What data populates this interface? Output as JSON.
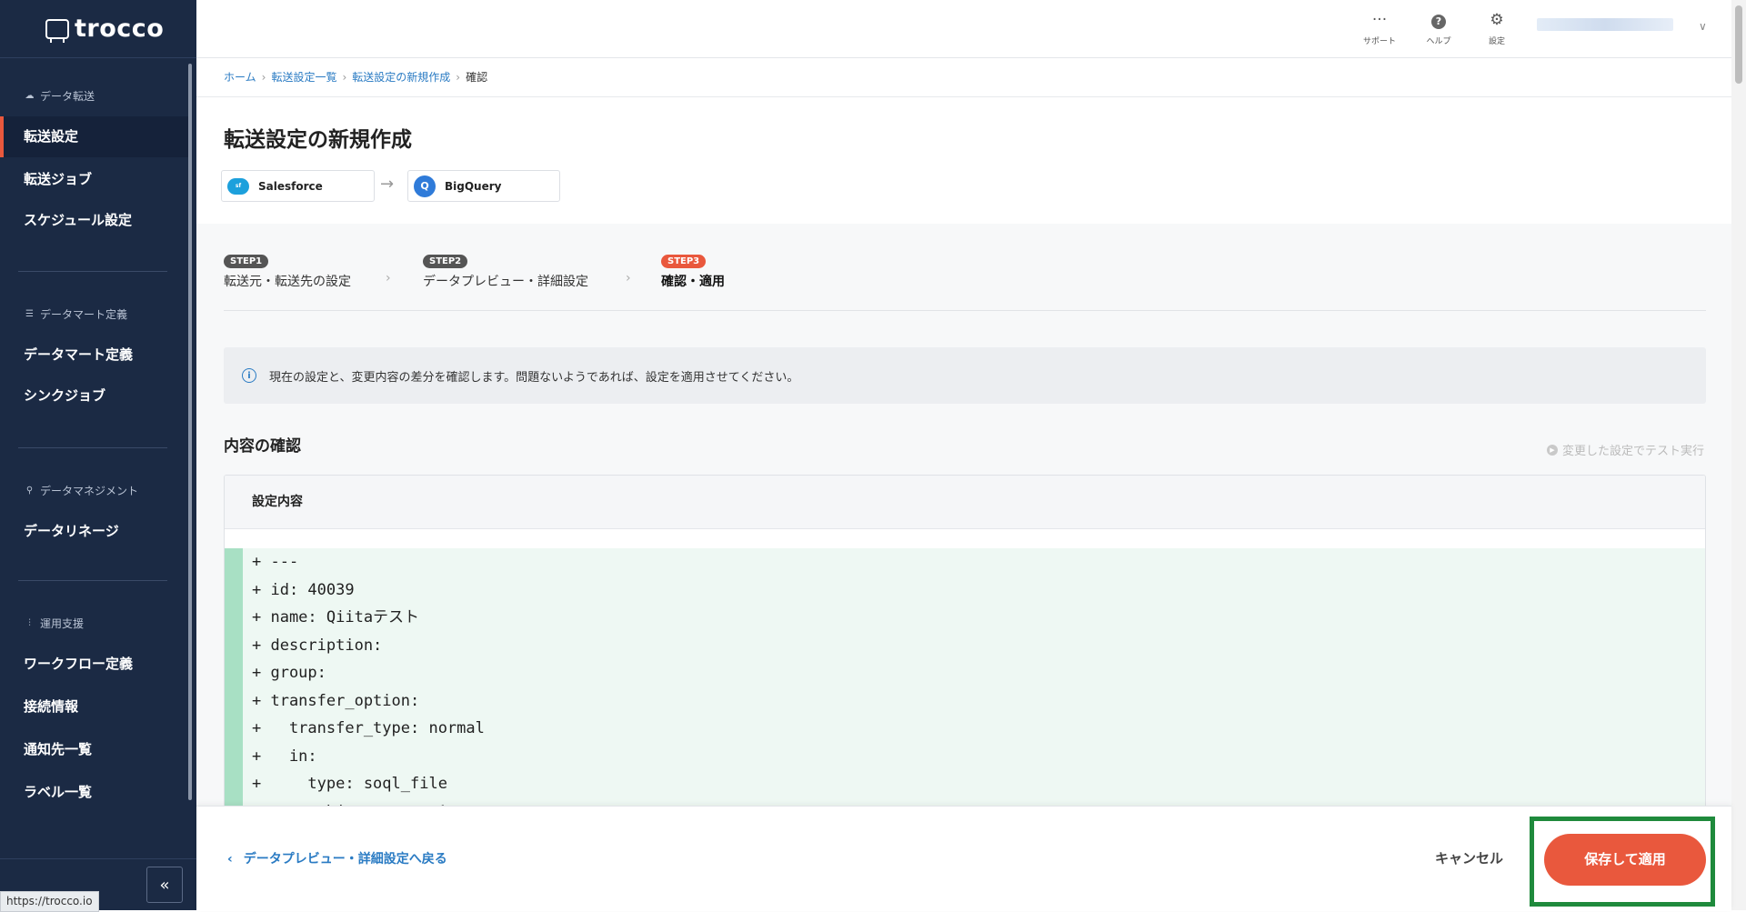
{
  "app": {
    "logo": "trocco"
  },
  "sidebar": {
    "sections": [
      {
        "title": "データ転送",
        "icon": "cloud-icon",
        "items": [
          "転送設定",
          "転送ジョブ",
          "スケジュール設定"
        ]
      },
      {
        "title": "データマート定義",
        "icon": "list-icon",
        "items": [
          "データマート定義",
          "シンクジョブ"
        ]
      },
      {
        "title": "データマネジメント",
        "icon": "lineage-icon",
        "items": [
          "データリネージ"
        ]
      },
      {
        "title": "運用支援",
        "icon": "sliders-icon",
        "items": [
          "ワークフロー定義",
          "接続情報",
          "通知先一覧",
          "ラベル一覧"
        ]
      }
    ],
    "active_item": "転送設定",
    "collapse_label": "«"
  },
  "header": {
    "support_label": "サポート",
    "help_label": "ヘルプ",
    "settings_label": "設定"
  },
  "breadcrumb": {
    "home": "ホーム",
    "list": "転送設定一覧",
    "new": "転送設定の新規作成",
    "current": "確認"
  },
  "page": {
    "title": "転送設定の新規作成",
    "source": "Salesforce",
    "destination": "BigQuery"
  },
  "steps": [
    {
      "badge": "STEP1",
      "label": "転送元・転送先の設定"
    },
    {
      "badge": "STEP2",
      "label": "データプレビュー・詳細設定"
    },
    {
      "badge": "STEP3",
      "label": "確認・適用"
    }
  ],
  "info": {
    "text": "現在の設定と、変更内容の差分を確認します。問題ないようであれば、設定を適用させてください。"
  },
  "confirm": {
    "heading": "内容の確認",
    "test_run": "変更した設定でテスト実行",
    "card_title": "設定内容",
    "diff_lines": [
      "+ ---",
      "+ id: 40039",
      "+ name: Qiitaテスト",
      "+ description:",
      "+ group:",
      "+ transfer_option:",
      "+   transfer_type: normal",
      "+   in:",
      "+     type: soql_file",
      "+     sobject_name: Account"
    ]
  },
  "footer": {
    "back_label": "データプレビュー・詳細設定へ戻る",
    "cancel_label": "キャンセル",
    "save_label": "保存して適用"
  },
  "status_bar": {
    "url": "https://trocco.io"
  },
  "colors": {
    "accent": "#e9583d",
    "sidebar": "#1b2a44",
    "link": "#2a7bc3",
    "highlight": "#1f8a3c"
  }
}
